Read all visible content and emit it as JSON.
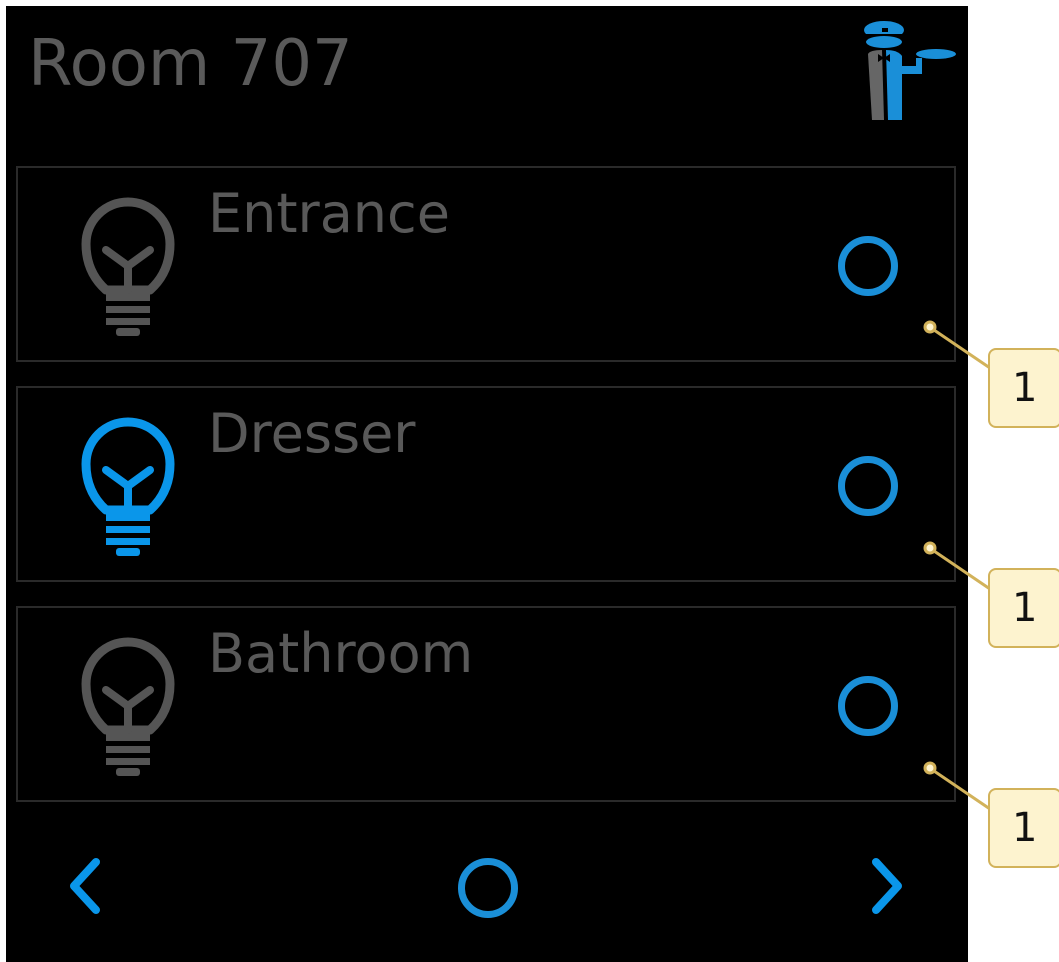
{
  "header": {
    "title": "Room 707",
    "logo_icon": "butler-waiter-icon"
  },
  "lights": [
    {
      "name": "Entrance",
      "state": "off",
      "icon": "lightbulb-icon",
      "toggle_icon": "circle-toggle-icon"
    },
    {
      "name": "Dresser",
      "state": "on",
      "icon": "lightbulb-icon",
      "toggle_icon": "circle-toggle-icon"
    },
    {
      "name": "Bathroom",
      "state": "off",
      "icon": "lightbulb-icon",
      "toggle_icon": "circle-toggle-icon"
    }
  ],
  "nav": {
    "prev_icon": "chevron-left-icon",
    "home_icon": "circle-home-icon",
    "next_icon": "chevron-right-icon"
  },
  "callouts": [
    "1",
    "1",
    "1"
  ],
  "colors": {
    "accent": "#1a8fd8",
    "bulb_off": "#555555",
    "text_dim": "#595959",
    "background": "#000000",
    "callout_fill": "#fdf3cf",
    "callout_border": "#d2b25a"
  }
}
